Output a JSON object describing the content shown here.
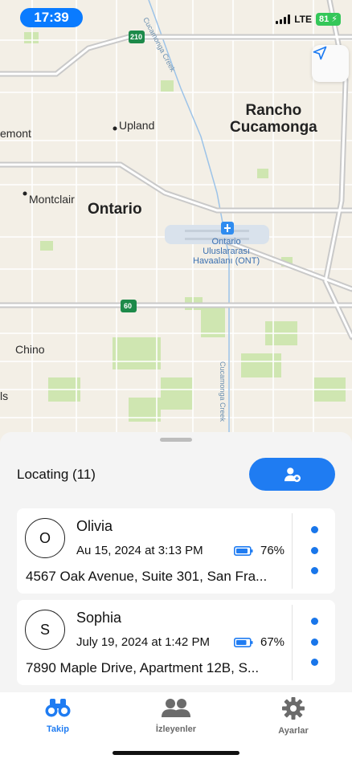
{
  "status_bar": {
    "time": "17:39",
    "network": "LTE",
    "battery": "81"
  },
  "map": {
    "labels": {
      "rancho": "Rancho\nCucamonga",
      "upland": "Upland",
      "emont": "emont",
      "montclair": "Montclair",
      "ontario": "Ontario",
      "airport": "Ontario\nUluslararası\nHavaalanı (ONT)",
      "chino": "Chino",
      "ls": "ls",
      "creek_top": "Cucamonga Creek",
      "creek_bottom": "Cucamonga Creek",
      "shield_210": "210",
      "shield_60": "60"
    }
  },
  "sheet": {
    "title": "Locating (11)",
    "people": [
      {
        "initial": "O",
        "name": "Olivia",
        "datetime": "Au 15, 2024 at 3:13 PM",
        "battery": "76%",
        "address": "4567 Oak Avenue, Suite 301, San Fra..."
      },
      {
        "initial": "S",
        "name": "Sophia",
        "datetime": "July 19, 2024 at 1:42 PM",
        "battery": "67%",
        "address": "7890 Maple Drive, Apartment 12B, S..."
      }
    ]
  },
  "tabs": [
    {
      "label": "Takip",
      "icon": "binoculars-icon",
      "active": true
    },
    {
      "label": "İzleyenler",
      "icon": "people-icon",
      "active": false
    },
    {
      "label": "Ayarlar",
      "icon": "gear-icon",
      "active": false
    }
  ],
  "colors": {
    "accent": "#1f7cf2",
    "tab_active": "#1f7cf2",
    "tab_inactive": "#6b6b6b"
  }
}
